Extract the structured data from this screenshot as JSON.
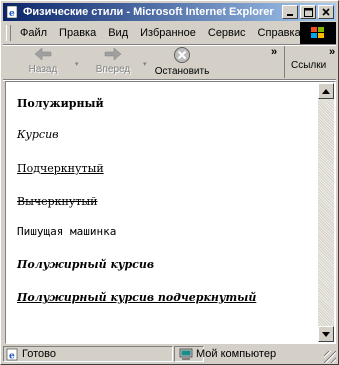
{
  "window": {
    "title": "Физические стили - Microsoft Internet Explorer",
    "controls": [
      "minimize",
      "maximize",
      "close"
    ]
  },
  "menu": {
    "items": [
      "Файл",
      "Правка",
      "Вид",
      "Избранное",
      "Сервис",
      "Справка"
    ]
  },
  "toolbar": {
    "back_label": "Назад",
    "forward_label": "Вперед",
    "stop_label": "Остановить",
    "chevron": "»",
    "links_label": "Ссылки"
  },
  "document": {
    "lines": [
      {
        "text": "Полужирный",
        "style": "bold"
      },
      {
        "text": "Курсив",
        "style": "italic"
      },
      {
        "text": "Подчеркнутый",
        "style": "underline"
      },
      {
        "text": "Вычеркнутый",
        "style": "strike"
      },
      {
        "text": "Пишущая машинка",
        "style": "mono"
      },
      {
        "text": "Полужирный курсив",
        "style": "bold-italic"
      },
      {
        "text": "Полужирный курсив подчеркнутый",
        "style": "bold-italic-underline"
      }
    ]
  },
  "status": {
    "text": "Готово",
    "zone": "Мой компьютер"
  },
  "icons": {
    "app": "ie-page-icon",
    "back": "back-arrow-icon",
    "forward": "forward-arrow-icon",
    "stop": "stop-icon",
    "throbber": "windows-logo-icon",
    "status": "ie-page-icon",
    "zone": "my-computer-icon"
  }
}
